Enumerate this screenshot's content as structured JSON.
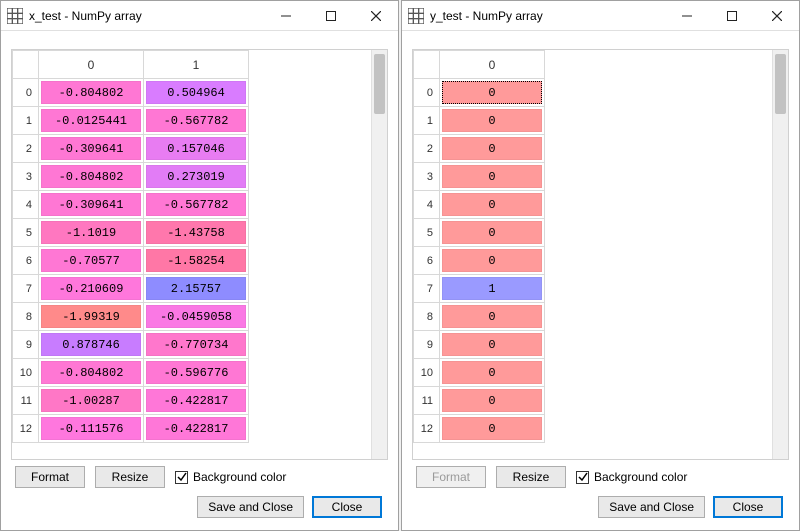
{
  "windows": [
    {
      "title": "x_test - NumPy array",
      "columns": [
        "0",
        "1"
      ],
      "rows": [
        {
          "idx": "0",
          "cells": [
            {
              "v": "-0.804802",
              "c": "#ff77d4"
            },
            {
              "v": "0.504964",
              "c": "#d97cff"
            }
          ]
        },
        {
          "idx": "1",
          "cells": [
            {
              "v": "-0.0125441",
              "c": "#ff77d4"
            },
            {
              "v": "-0.567782",
              "c": "#ff77d4"
            }
          ]
        },
        {
          "idx": "2",
          "cells": [
            {
              "v": "-0.309641",
              "c": "#ff77d4"
            },
            {
              "v": "0.157046",
              "c": "#e87cf2"
            }
          ]
        },
        {
          "idx": "3",
          "cells": [
            {
              "v": "-0.804802",
              "c": "#ff77d4"
            },
            {
              "v": "0.273019",
              "c": "#e27cf6"
            }
          ]
        },
        {
          "idx": "4",
          "cells": [
            {
              "v": "-0.309641",
              "c": "#ff77d4"
            },
            {
              "v": "-0.567782",
              "c": "#ff77d4"
            }
          ]
        },
        {
          "idx": "5",
          "cells": [
            {
              "v": "-1.1019",
              "c": "#ff77c0"
            },
            {
              "v": "-1.43758",
              "c": "#ff77ac"
            }
          ]
        },
        {
          "idx": "6",
          "cells": [
            {
              "v": "-0.70577",
              "c": "#ff77d4"
            },
            {
              "v": "-1.58254",
              "c": "#ff77a6"
            }
          ]
        },
        {
          "idx": "7",
          "cells": [
            {
              "v": "-0.210609",
              "c": "#ff77dc"
            },
            {
              "v": "2.15757",
              "c": "#8e8cff"
            }
          ]
        },
        {
          "idx": "8",
          "cells": [
            {
              "v": "-1.99319",
              "c": "#ff8a8a"
            },
            {
              "v": "-0.0459058",
              "c": "#fa78e4"
            }
          ]
        },
        {
          "idx": "9",
          "cells": [
            {
              "v": "0.878746",
              "c": "#c87cff"
            },
            {
              "v": "-0.770734",
              "c": "#ff77cc"
            }
          ]
        },
        {
          "idx": "10",
          "cells": [
            {
              "v": "-0.804802",
              "c": "#ff77d4"
            },
            {
              "v": "-0.596776",
              "c": "#ff77d4"
            }
          ]
        },
        {
          "idx": "11",
          "cells": [
            {
              "v": "-1.00287",
              "c": "#ff77c6"
            },
            {
              "v": "-0.422817",
              "c": "#ff77d8"
            }
          ]
        },
        {
          "idx": "12",
          "cells": [
            {
              "v": "-0.111576",
              "c": "#ff77de"
            },
            {
              "v": "-0.422817",
              "c": "#ff77d8"
            }
          ]
        }
      ],
      "format_disabled": false
    },
    {
      "title": "y_test - NumPy array",
      "columns": [
        "0"
      ],
      "rows": [
        {
          "idx": "0",
          "cells": [
            {
              "v": "0",
              "c": "#ff9a9a",
              "sel": true
            }
          ]
        },
        {
          "idx": "1",
          "cells": [
            {
              "v": "0",
              "c": "#ff9a9a"
            }
          ]
        },
        {
          "idx": "2",
          "cells": [
            {
              "v": "0",
              "c": "#ff9a9a"
            }
          ]
        },
        {
          "idx": "3",
          "cells": [
            {
              "v": "0",
              "c": "#ff9a9a"
            }
          ]
        },
        {
          "idx": "4",
          "cells": [
            {
              "v": "0",
              "c": "#ff9a9a"
            }
          ]
        },
        {
          "idx": "5",
          "cells": [
            {
              "v": "0",
              "c": "#ff9a9a"
            }
          ]
        },
        {
          "idx": "6",
          "cells": [
            {
              "v": "0",
              "c": "#ff9a9a"
            }
          ]
        },
        {
          "idx": "7",
          "cells": [
            {
              "v": "1",
              "c": "#9a9aff"
            }
          ]
        },
        {
          "idx": "8",
          "cells": [
            {
              "v": "0",
              "c": "#ff9a9a"
            }
          ]
        },
        {
          "idx": "9",
          "cells": [
            {
              "v": "0",
              "c": "#ff9a9a"
            }
          ]
        },
        {
          "idx": "10",
          "cells": [
            {
              "v": "0",
              "c": "#ff9a9a"
            }
          ]
        },
        {
          "idx": "11",
          "cells": [
            {
              "v": "0",
              "c": "#ff9a9a"
            }
          ]
        },
        {
          "idx": "12",
          "cells": [
            {
              "v": "0",
              "c": "#ff9a9a"
            }
          ]
        }
      ],
      "format_disabled": true
    }
  ],
  "labels": {
    "format": "Format",
    "resize": "Resize",
    "bgcolor": "Background color",
    "save_close": "Save and Close",
    "close": "Close"
  }
}
